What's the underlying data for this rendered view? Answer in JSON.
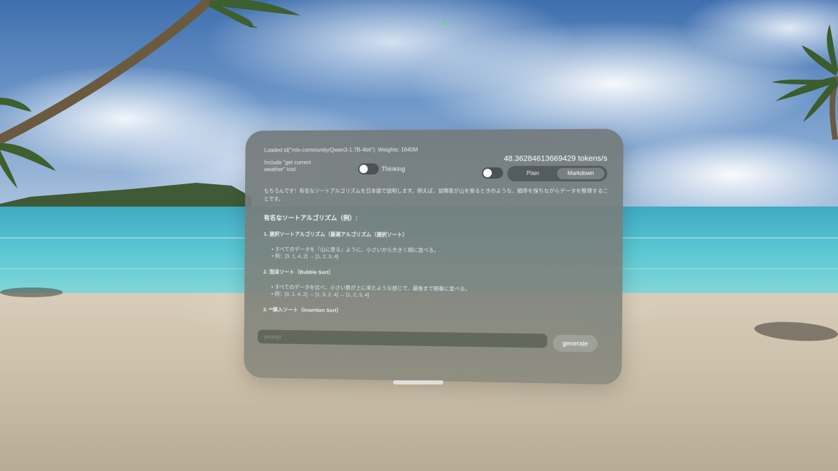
{
  "window": {
    "model_info": "Loaded id(\"mlx-community/Qwen3-1.7B-4bit\").  Weights: 1640M",
    "tokens_per_sec": "48.36284613669429 tokens/s",
    "weather_tool_label": "Include \"get current weather\" tool",
    "thinking_label": "Thinking",
    "weather_tool_enabled": false,
    "thinking_enabled": false,
    "format_toggle_enabled": false,
    "format_segment": {
      "options": [
        "Plain",
        "Markdown"
      ],
      "selected": "Markdown"
    },
    "output": {
      "intro": "もちろんです！有名なソートアルゴリズムを日本語で説明します。例えば、冒険家が山を登るときのような、順序を保ちながらデータを整理することです。",
      "heading": "有名なソートアルゴリズム（例）:",
      "sections": [
        {
          "title": "1. 選択ソートアルゴリズム（最適アルゴリズム（選択ソート）",
          "items": [
            "• すべてのデータを「山に登る」ように、小さいから大きく順に並べる。",
            "• 例：[3, 1, 4, 2] → [1, 2, 3, 4]"
          ]
        },
        {
          "title": "2. 泡沫ソート（Bubble Sort）",
          "items": [
            "• すべてのデータを比べ、小さい数が上に来たような感じで、最後まで順番に並べる。",
            "• 例：[3, 1, 4, 2] → [1, 3, 2, 4] → [1, 2, 3, 4]"
          ]
        },
        {
          "title": "3. **挿入ソート（Insertion Sort）",
          "items": []
        }
      ]
    },
    "prompt": {
      "placeholder": "prompt",
      "value": ""
    },
    "generate_label": "generate"
  },
  "colors": {
    "window_glass": "#787e7c",
    "sea": "#58c6d2",
    "sand": "#cbbfa9",
    "sky": "#6f98c9"
  }
}
